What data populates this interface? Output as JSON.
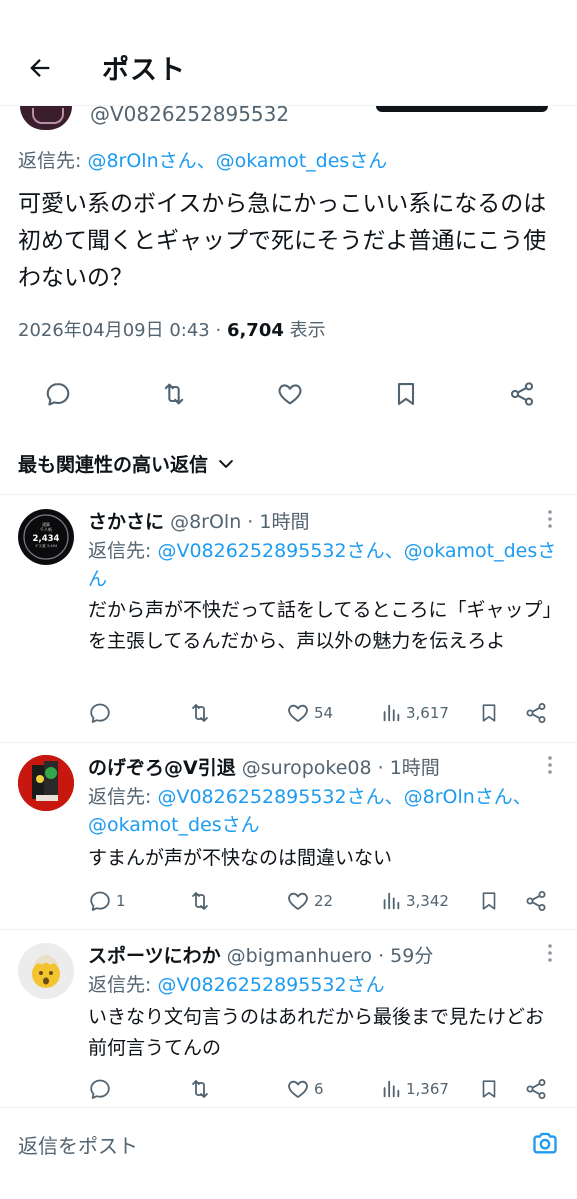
{
  "header": {
    "title": "ポスト",
    "back_icon": "arrow-left-icon"
  },
  "main_post": {
    "handle": "@V0826252895532",
    "reply_prefix": "返信先: ",
    "reply_to": "@8rOlnさん、@okamot_desさん",
    "text": "可愛い系のボイスから急にかっこいい系になるのは初めて聞くとギャップで死にそうだよ普通にこう使わないの？",
    "datetime": "2026年04月09日 0:43 · ",
    "views_count": "6,704",
    "views_label": " 表示"
  },
  "sort": {
    "label": "最も関連性の高い返信"
  },
  "replies": [
    {
      "name": "さかさに",
      "handle": "@8rOln · 1時間",
      "reply_prefix": "返信先: ",
      "reply_to": "@V0826252895532さん、@okamot_desさん",
      "text": "だから声が不快だって話をしてるところに「ギャップ」を主張してるんだから、声以外の魅力を伝えろよ",
      "reply_count": "",
      "like_count": "54",
      "view_count": "3,617",
      "avatar_text": [
        "通算",
        "千人斬",
        "2,434",
        "ゲス度 3,484"
      ]
    },
    {
      "name": "のげぞろ@V引退",
      "handle": "@suropoke08 · 1時間",
      "reply_prefix": "返信先: ",
      "reply_to": "@V0826252895532さん、@8rOlnさん、@okamot_desさん",
      "text": "すまんが声が不快なのは間違いない",
      "reply_count": "1",
      "like_count": "22",
      "view_count": "3,342"
    },
    {
      "name": "スポーツにわか",
      "handle": "@bigmanhuero · 59分",
      "reply_prefix": "返信先: ",
      "reply_to": "@V0826252895532さん",
      "text": "いきなり文句言うのはあれだから最後まで見たけどお前何言うてんの",
      "reply_count": "",
      "like_count": "6",
      "view_count": "1,367"
    }
  ],
  "compose": {
    "placeholder": "返信をポスト"
  },
  "colors": {
    "accent": "#1d9bf0",
    "text": "#0f1419",
    "muted": "#536471",
    "divider": "#eff3f4"
  }
}
